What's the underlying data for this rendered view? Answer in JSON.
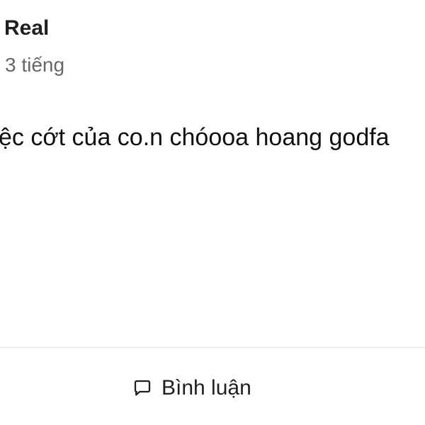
{
  "post": {
    "author_name": "Real",
    "timestamp": "3 tiếng",
    "text": "ệc cớt của co.n chóooa hoang godfa"
  },
  "actions": {
    "comment_label": "Bình luận",
    "comment_icon": "comment-icon"
  },
  "colors": {
    "text_primary": "#1f1f1f",
    "text_secondary": "#65676b",
    "divider": "#e4e6eb"
  }
}
